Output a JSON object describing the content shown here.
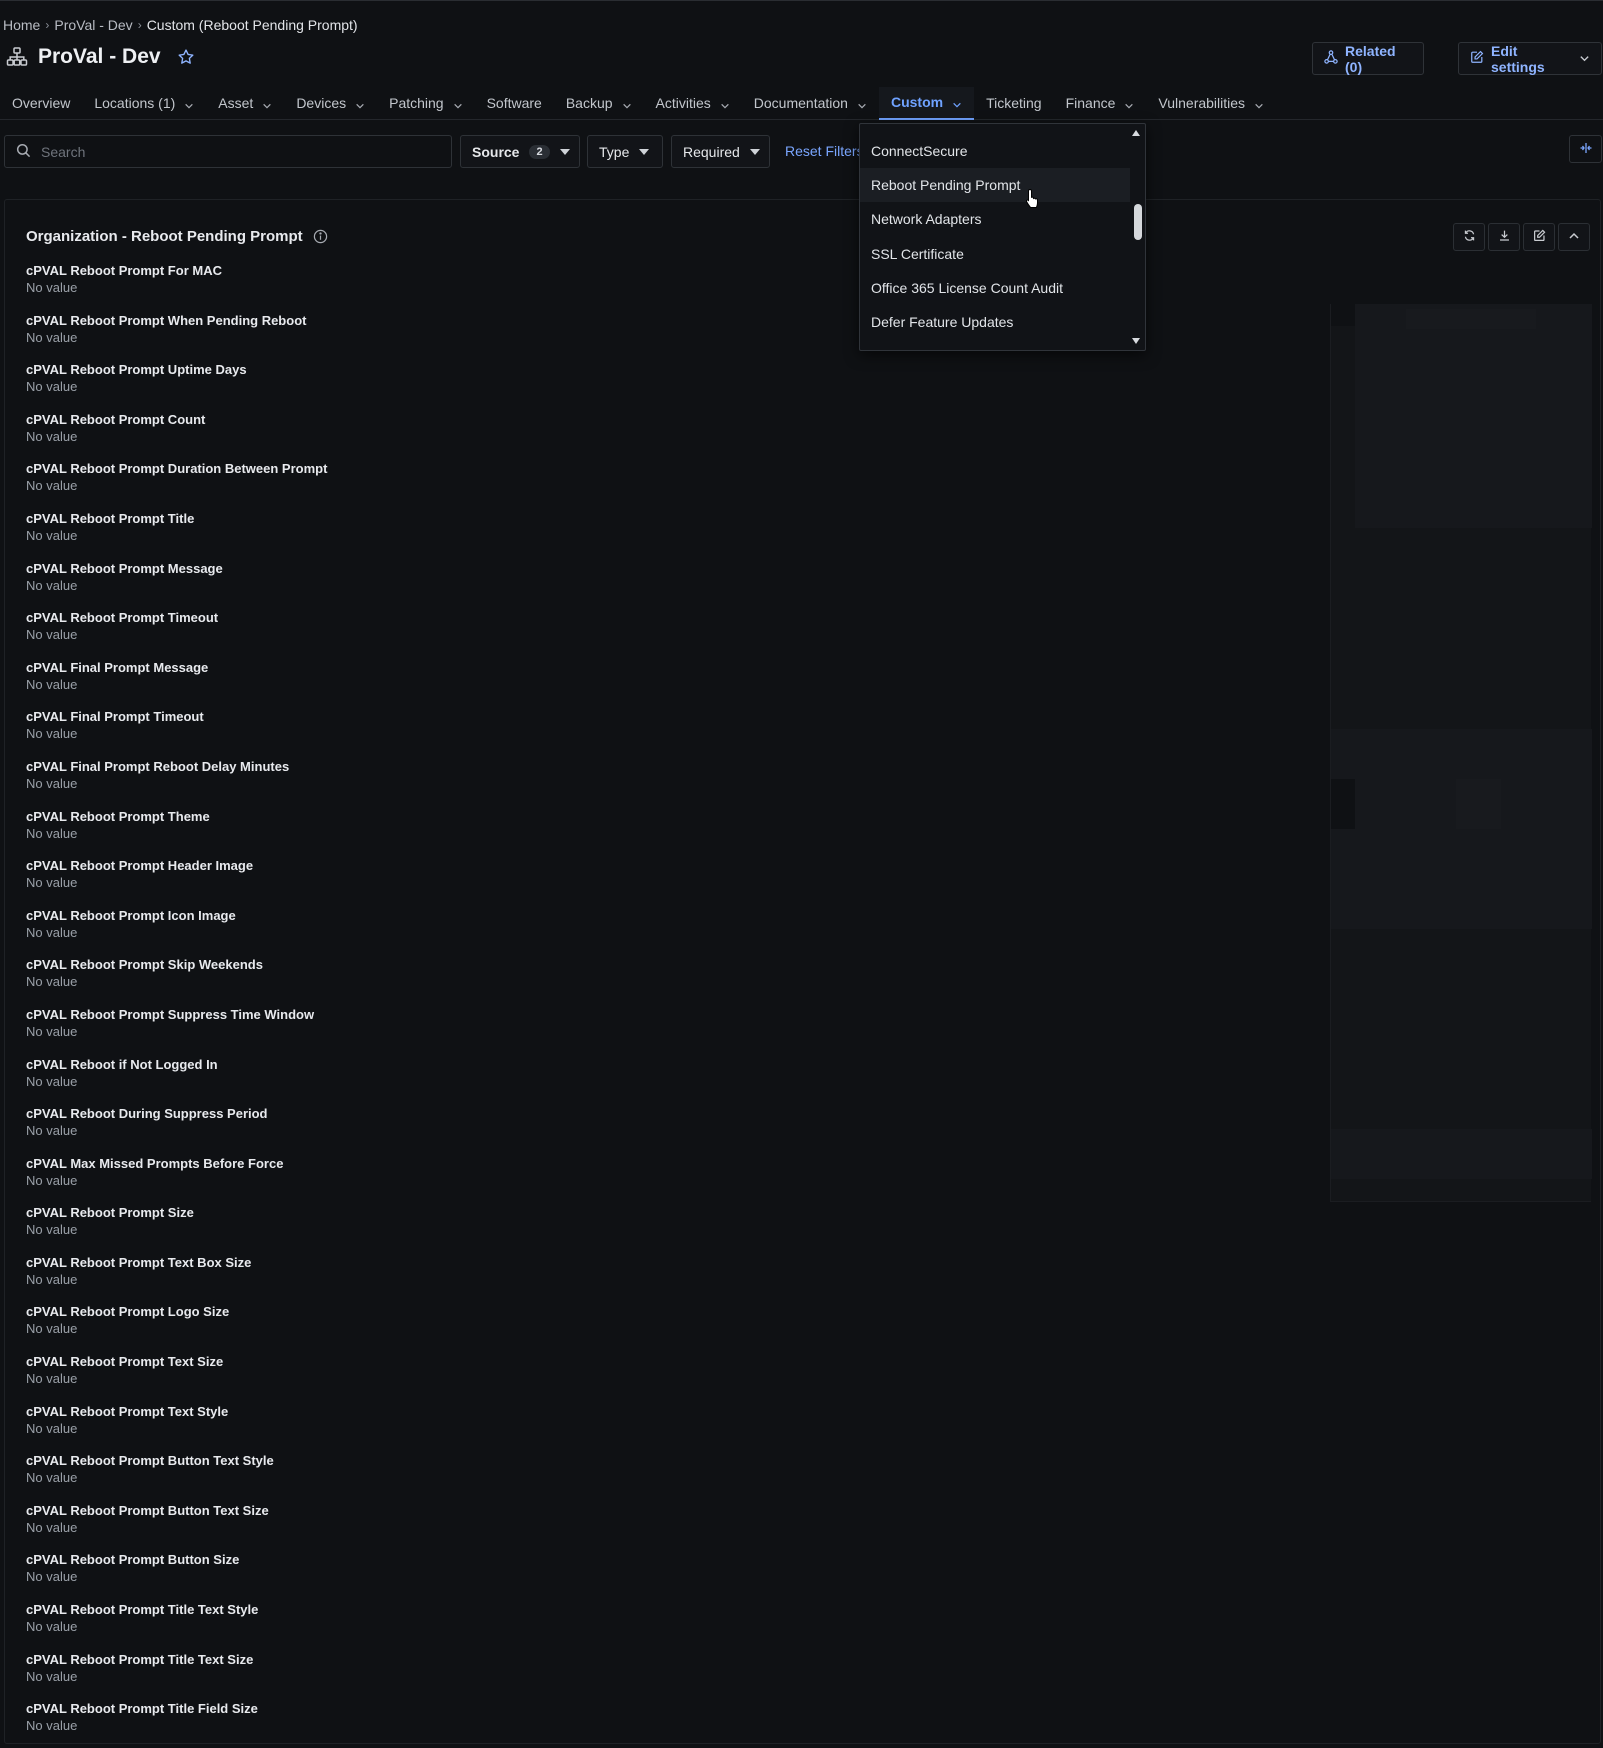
{
  "breadcrumb": {
    "items": [
      "Home",
      "ProVal - Dev"
    ],
    "current": "Custom (Reboot Pending Prompt)"
  },
  "header": {
    "title": "ProVal - Dev",
    "related_label": "Related (0)",
    "edit_settings_label": "Edit settings"
  },
  "tabs": [
    {
      "label": "Overview",
      "has_menu": false
    },
    {
      "label": "Locations (1)",
      "has_menu": true
    },
    {
      "label": "Asset",
      "has_menu": true
    },
    {
      "label": "Devices",
      "has_menu": true
    },
    {
      "label": "Patching",
      "has_menu": true
    },
    {
      "label": "Software",
      "has_menu": false
    },
    {
      "label": "Backup",
      "has_menu": true
    },
    {
      "label": "Activities",
      "has_menu": true
    },
    {
      "label": "Documentation",
      "has_menu": true
    },
    {
      "label": "Custom",
      "has_menu": true,
      "active": true
    },
    {
      "label": "Ticketing",
      "has_menu": false
    },
    {
      "label": "Finance",
      "has_menu": true
    },
    {
      "label": "Vulnerabilities",
      "has_menu": true
    }
  ],
  "filters": {
    "search_placeholder": "Search",
    "source_label": "Source",
    "source_count": "2",
    "type_label": "Type",
    "required_label": "Required",
    "reset_label": "Reset Filters"
  },
  "custom_menu": {
    "items": [
      "ConnectSecure",
      "Reboot Pending Prompt",
      "Network Adapters",
      "SSL Certificate",
      "Office 365 License Count Audit",
      "Defer Feature Updates"
    ],
    "hovered": "Reboot Pending Prompt"
  },
  "panel": {
    "title": "Organization - Reboot Pending Prompt",
    "fields": [
      {
        "label": "cPVAL Reboot Prompt For MAC",
        "value": "No value"
      },
      {
        "label": "cPVAL Reboot Prompt When Pending Reboot",
        "value": "No value"
      },
      {
        "label": "cPVAL Reboot Prompt Uptime Days",
        "value": "No value"
      },
      {
        "label": "cPVAL Reboot Prompt Count",
        "value": "No value"
      },
      {
        "label": "cPVAL Reboot Prompt Duration Between Prompt",
        "value": "No value"
      },
      {
        "label": "cPVAL Reboot Prompt Title",
        "value": "No value"
      },
      {
        "label": "cPVAL Reboot Prompt Message",
        "value": "No value"
      },
      {
        "label": "cPVAL Reboot Prompt Timeout",
        "value": "No value"
      },
      {
        "label": "cPVAL Final Prompt Message",
        "value": "No value"
      },
      {
        "label": "cPVAL Final Prompt Timeout",
        "value": "No value"
      },
      {
        "label": "cPVAL Final Prompt Reboot Delay Minutes",
        "value": "No value"
      },
      {
        "label": "cPVAL Reboot Prompt Theme",
        "value": "No value"
      },
      {
        "label": "cPVAL Reboot Prompt Header Image",
        "value": "No value"
      },
      {
        "label": "cPVAL Reboot Prompt Icon Image",
        "value": "No value"
      },
      {
        "label": "cPVAL Reboot Prompt Skip Weekends",
        "value": "No value"
      },
      {
        "label": "cPVAL Reboot Prompt Suppress Time Window",
        "value": "No value"
      },
      {
        "label": "cPVAL Reboot if Not Logged In",
        "value": "No value"
      },
      {
        "label": "cPVAL Reboot During Suppress Period",
        "value": "No value"
      },
      {
        "label": "cPVAL Max Missed Prompts Before Force",
        "value": "No value"
      },
      {
        "label": "cPVAL Reboot Prompt Size",
        "value": "No value"
      },
      {
        "label": "cPVAL Reboot Prompt Text Box Size",
        "value": "No value"
      },
      {
        "label": "cPVAL Reboot Prompt Logo Size",
        "value": "No value"
      },
      {
        "label": "cPVAL Reboot Prompt Text Size",
        "value": "No value"
      },
      {
        "label": "cPVAL Reboot Prompt Text Style",
        "value": "No value"
      },
      {
        "label": "cPVAL Reboot Prompt Button Text Style",
        "value": "No value"
      },
      {
        "label": "cPVAL Reboot Prompt Button Text Size",
        "value": "No value"
      },
      {
        "label": "cPVAL Reboot Prompt Button Size",
        "value": "No value"
      },
      {
        "label": "cPVAL Reboot Prompt Title Text Style",
        "value": "No value"
      },
      {
        "label": "cPVAL Reboot Prompt Title Text Size",
        "value": "No value"
      },
      {
        "label": "cPVAL Reboot Prompt Title Field Size",
        "value": "No value"
      }
    ]
  },
  "colors": {
    "background": "#0f1114",
    "accent": "#6fa2ff",
    "text": "#e8eaee",
    "muted": "#9aa0a8"
  }
}
